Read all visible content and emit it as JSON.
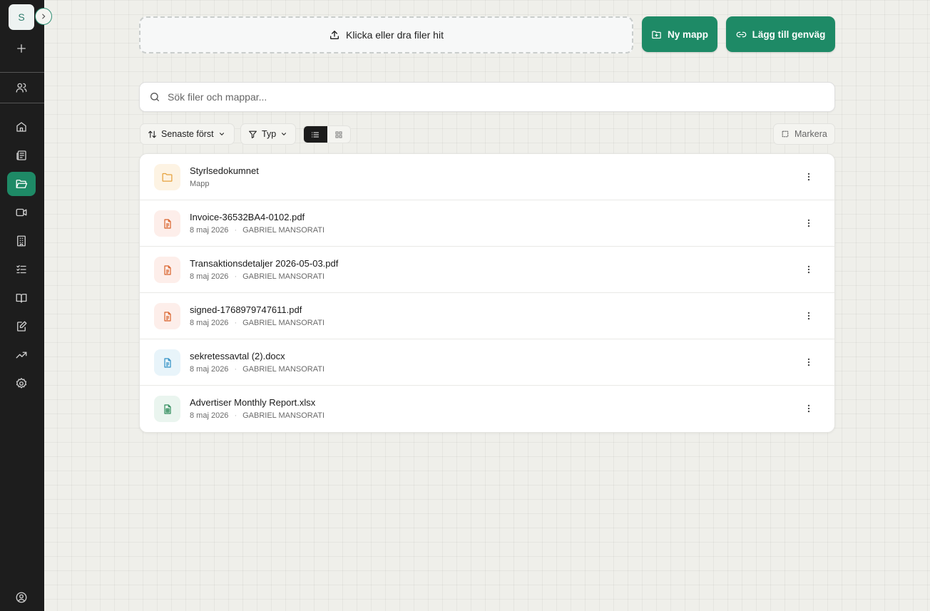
{
  "workspace": {
    "initial": "S"
  },
  "upload": {
    "label": "Klicka eller dra filer hit"
  },
  "actions": {
    "new_folder": "Ny mapp",
    "add_shortcut": "Lägg till genväg"
  },
  "search": {
    "placeholder": "Sök filer och mappar..."
  },
  "toolbar": {
    "sort_label": "Senaste först",
    "type_label": "Typ",
    "select_label": "Markera",
    "view_mode": "list"
  },
  "sidebar": {
    "items": [
      {
        "icon": "plus-icon"
      },
      {
        "icon": "users-icon"
      },
      {
        "icon": "home-icon"
      },
      {
        "icon": "newspaper-icon"
      },
      {
        "icon": "folder-open-icon",
        "active": true
      },
      {
        "icon": "video-icon"
      },
      {
        "icon": "building-icon"
      },
      {
        "icon": "checklist-icon"
      },
      {
        "icon": "book-open-icon"
      },
      {
        "icon": "edit-document-icon"
      },
      {
        "icon": "trending-up-icon"
      },
      {
        "icon": "settings-icon"
      },
      {
        "icon": "user-circle-icon"
      }
    ]
  },
  "files": [
    {
      "name": "Styrlsedokumnet",
      "subtitle": "Mapp",
      "kind": "folder"
    },
    {
      "name": "Invoice-36532BA4-0102.pdf",
      "date": "8 maj 2026",
      "owner": "GABRIEL MANSORATI",
      "kind": "pdf"
    },
    {
      "name": "Transaktionsdetaljer 2026-05-03.pdf",
      "date": "8 maj 2026",
      "owner": "GABRIEL MANSORATI",
      "kind": "pdf"
    },
    {
      "name": "signed-1768979747611.pdf",
      "date": "8 maj 2026",
      "owner": "GABRIEL MANSORATI",
      "kind": "pdf"
    },
    {
      "name": "sekretessavtal (2).docx",
      "date": "8 maj 2026",
      "owner": "GABRIEL MANSORATI",
      "kind": "docx"
    },
    {
      "name": "Advertiser Monthly Report.xlsx",
      "date": "8 maj 2026",
      "owner": "GABRIEL MANSORATI",
      "kind": "xlsx"
    }
  ],
  "colors": {
    "accent": "#1e8a66",
    "folder_bg": "#fdf3e3",
    "folder_fg": "#e6a23c",
    "pdf_bg": "#fdeeea",
    "pdf_fg": "#d9622b",
    "docx_bg": "#e8f4fa",
    "docx_fg": "#2f8fc4",
    "xlsx_bg": "#eaf5ef",
    "xlsx_fg": "#2e8b5a"
  }
}
